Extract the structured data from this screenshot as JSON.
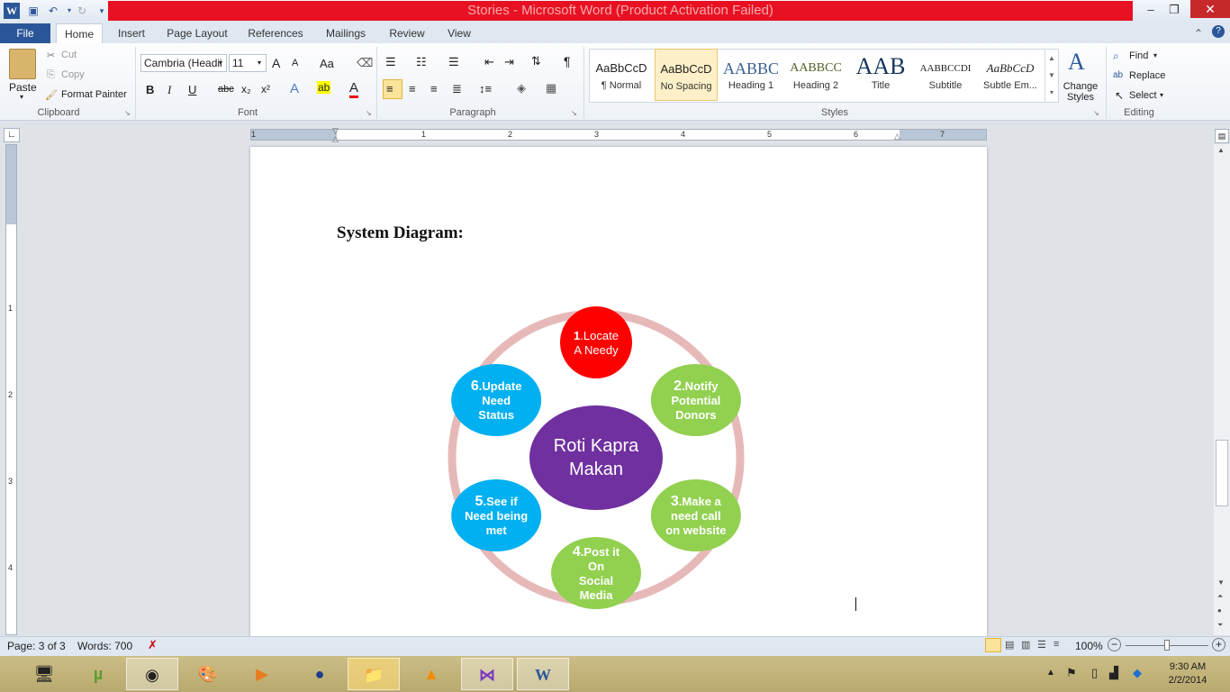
{
  "window": {
    "title": "Stories  -  Microsoft Word (Product Activation Failed)"
  },
  "qat": {
    "save_icon": "save-icon",
    "undo_icon": "undo-icon",
    "redo_icon": "redo-icon"
  },
  "tabs": [
    {
      "label": "File"
    },
    {
      "label": "Home"
    },
    {
      "label": "Insert"
    },
    {
      "label": "Page Layout"
    },
    {
      "label": "References"
    },
    {
      "label": "Mailings"
    },
    {
      "label": "Review"
    },
    {
      "label": "View"
    }
  ],
  "clipboard": {
    "paste": "Paste",
    "cut": "Cut",
    "copy": "Copy",
    "format_painter": "Format Painter",
    "group": "Clipboard"
  },
  "font": {
    "family": "Cambria (Headii",
    "size": "11",
    "grow": "A",
    "shrink": "A",
    "case": "Aa",
    "bold": "B",
    "italic": "I",
    "underline": "U",
    "strike": "abc",
    "sub": "x₂",
    "sup": "x²",
    "group": "Font"
  },
  "paragraph": {
    "group": "Paragraph",
    "pilcrow": "¶"
  },
  "styles": {
    "group": "Styles",
    "items": [
      {
        "sample": "AaBbCcD",
        "name": "¶ Normal"
      },
      {
        "sample": "AaBbCcD",
        "name": "No Spacing"
      },
      {
        "sample": "AABBC",
        "name": "Heading 1"
      },
      {
        "sample": "AABBCC",
        "name": "Heading 2"
      },
      {
        "sample": "AAB",
        "name": "Title"
      },
      {
        "sample": "AABBCCDI",
        "name": "Subtitle"
      },
      {
        "sample": "AaBbCcD",
        "name": "Subtle Em..."
      }
    ],
    "change_styles": "Change Styles"
  },
  "editing": {
    "find": "Find",
    "replace": "Replace",
    "select": "Select",
    "group": "Editing"
  },
  "ruler": {
    "numbers": [
      "1",
      "1",
      "2",
      "3",
      "4",
      "5",
      "6",
      "7"
    ],
    "vnumbers": [
      "1",
      "2",
      "3",
      "4"
    ]
  },
  "document": {
    "heading": "System Diagram:",
    "diagram": {
      "center": "Roti Kapra Makan",
      "nodes": [
        {
          "num": "1",
          "text": ".Locate A Needy",
          "color": "#ff0000"
        },
        {
          "num": "2",
          "text": ".Notify Potential Donors",
          "color": "#92d050"
        },
        {
          "num": "3",
          "text": ".Make a need call on website",
          "color": "#92d050"
        },
        {
          "num": "4",
          "text": ".Post it On Social Media",
          "color": "#92d050"
        },
        {
          "num": "5",
          "text": ".See if Need being met",
          "color": "#00b0f0"
        },
        {
          "num": "6",
          "text": ".Update Need Status",
          "color": "#00b0f0"
        }
      ],
      "center_color": "#7030a0",
      "ring_color": "#e6b9b8"
    }
  },
  "status": {
    "page": "Page: 3 of 3",
    "words": "Words: 700",
    "zoom": "100%"
  },
  "taskbar": {
    "time": "9:30 AM",
    "date": "2/2/2014"
  }
}
